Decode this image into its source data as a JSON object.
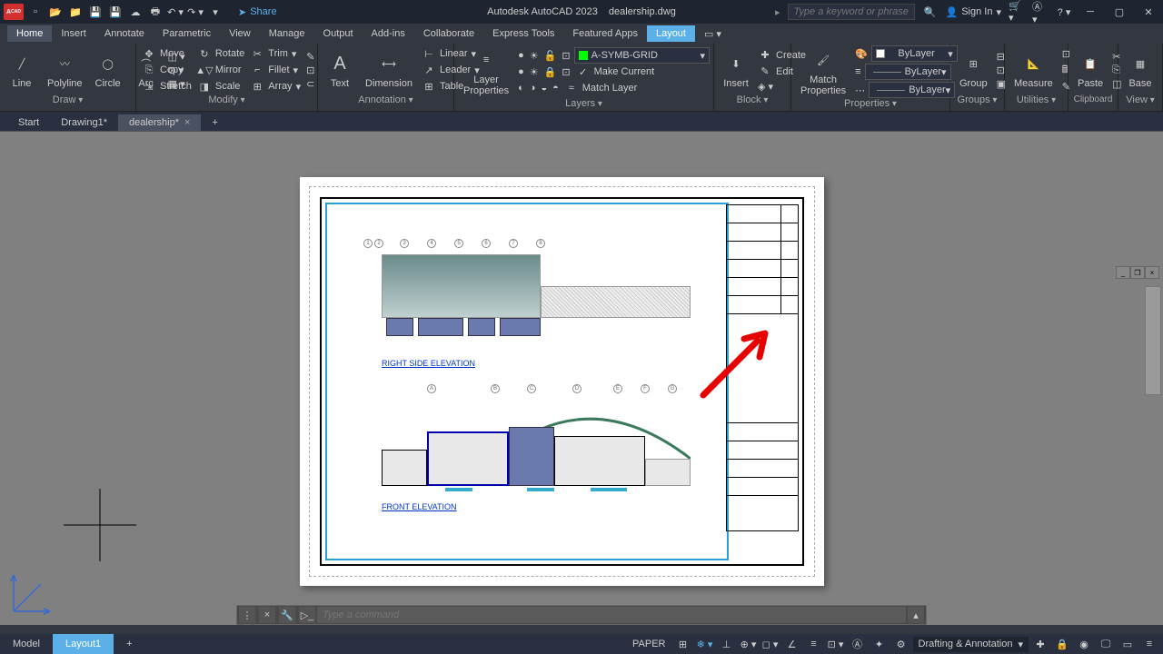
{
  "app": {
    "title": "Autodesk AutoCAD 2023",
    "file": "dealership.dwg"
  },
  "qat": {
    "share": "Share"
  },
  "search": {
    "placeholder": "Type a keyword or phrase"
  },
  "signin": "Sign In",
  "menu": [
    "Home",
    "Insert",
    "Annotate",
    "Parametric",
    "View",
    "Manage",
    "Output",
    "Add-ins",
    "Collaborate",
    "Express Tools",
    "Featured Apps",
    "Layout"
  ],
  "draw": {
    "line": "Line",
    "polyline": "Polyline",
    "circle": "Circle",
    "arc": "Arc",
    "title": "Draw"
  },
  "modify": {
    "move": "Move",
    "rotate": "Rotate",
    "trim": "Trim",
    "copy": "Copy",
    "mirror": "Mirror",
    "fillet": "Fillet",
    "stretch": "Stretch",
    "scale": "Scale",
    "array": "Array",
    "title": "Modify"
  },
  "anno": {
    "text": "Text",
    "dim": "Dimension",
    "linear": "Linear",
    "leader": "Leader",
    "table": "Table",
    "title": "Annotation"
  },
  "layers": {
    "props": "Layer\nProperties",
    "current": "A-SYMB-GRID",
    "make": "Make Current",
    "match": "Match Layer",
    "title": "Layers"
  },
  "block": {
    "insert": "Insert",
    "create": "Create",
    "edit": "Edit",
    "title": "Block"
  },
  "props": {
    "match": "Match\nProperties",
    "bylayer": "ByLayer",
    "title": "Properties"
  },
  "groups": {
    "group": "Group",
    "title": "Groups"
  },
  "util": {
    "measure": "Measure",
    "title": "Utilities"
  },
  "clip": {
    "paste": "Paste",
    "title": "Clipboard"
  },
  "view": {
    "base": "Base",
    "title": "View"
  },
  "doctabs": {
    "start": "Start",
    "d1": "Drawing1*",
    "d2": "dealership*"
  },
  "drawing": {
    "right_elev": "RIGHT SIDE ELEVATION",
    "front_elev": "FRONT ELEVATION"
  },
  "cmd": {
    "placeholder": "Type a command"
  },
  "layouts": {
    "model": "Model",
    "l1": "Layout1"
  },
  "status": {
    "paper": "PAPER",
    "workspace": "Drafting & Annotation"
  }
}
